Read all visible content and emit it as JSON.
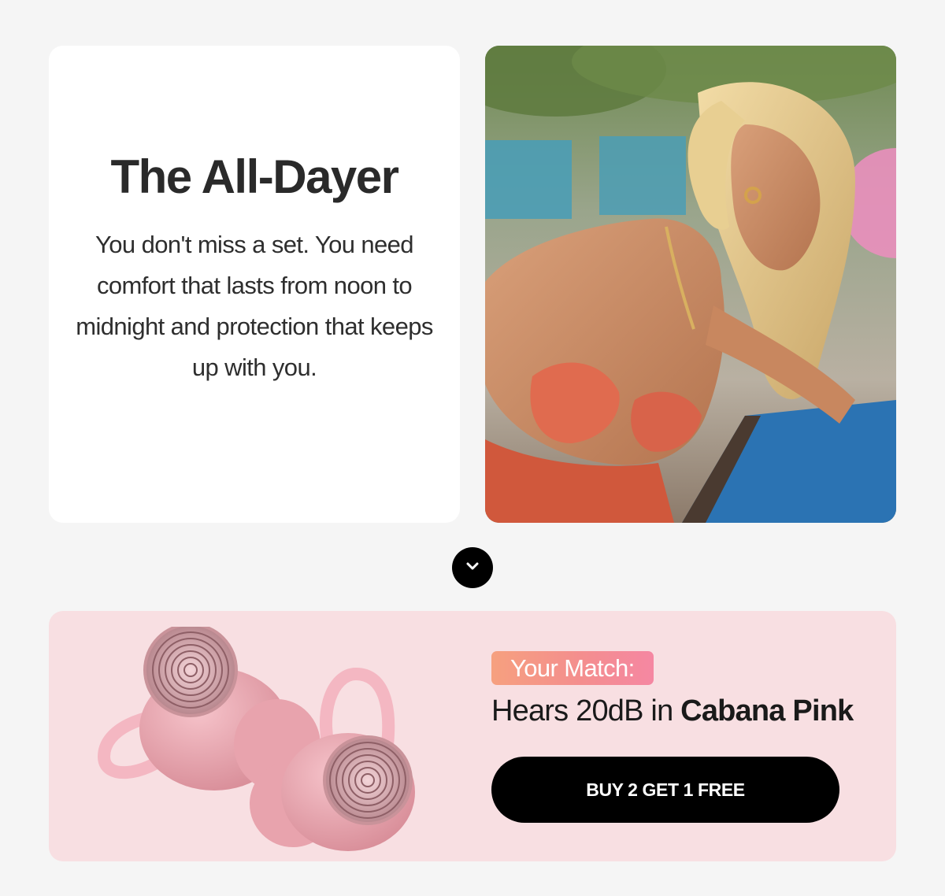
{
  "intro": {
    "title": "The All-Dayer",
    "body": "You don't miss a set. You need comfort that lasts from noon to midnight and protection that keeps up with you."
  },
  "photo": {
    "icon": "lifestyle-photo"
  },
  "divider": {
    "icon": "chevron-down-icon"
  },
  "match": {
    "badge": "Your Match:",
    "prefix": "Hears 20dB in ",
    "product": "Cabana Pink",
    "cta": "BUY 2 GET 1 FREE",
    "accent_color": "#f8dfe2",
    "badge_gradient": [
      "#f6a07f",
      "#f587a2"
    ]
  }
}
